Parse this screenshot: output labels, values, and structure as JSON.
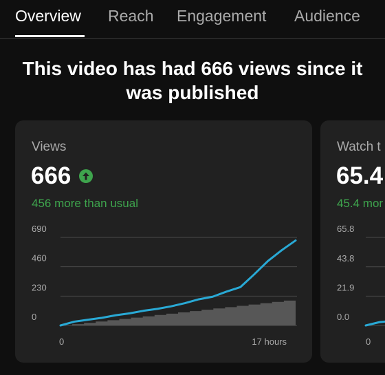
{
  "tabs": [
    {
      "label": "Overview",
      "active": true
    },
    {
      "label": "Reach",
      "active": false
    },
    {
      "label": "Engagement",
      "active": false
    },
    {
      "label": "Audience",
      "active": false
    }
  ],
  "headline": "This video has had 666 views since it was published",
  "cards": [
    {
      "label": "Views",
      "value": "666",
      "trend_icon": "arrow-up-circle-icon",
      "delta": "456 more than usual"
    },
    {
      "label": "Watch t",
      "value": "65.4",
      "delta": "45.4 mor"
    }
  ],
  "colors": {
    "background": "#0f0f0f",
    "card": "#212121",
    "accent_line": "#29a9d5",
    "typical_range": "#575757",
    "positive": "#3ea44d",
    "muted_text": "#aaaaaa"
  },
  "chart_data": [
    {
      "type": "line",
      "ylim": [
        0,
        690
      ],
      "y_ticks": [
        "690",
        "460",
        "230",
        "0"
      ],
      "y_tick_values": [
        690,
        460,
        230,
        0
      ],
      "x_tick_labels": [
        "0",
        "17 hours"
      ],
      "grid": true,
      "series": [
        {
          "x": [
            0,
            1,
            2,
            3,
            4,
            5,
            6,
            7,
            8,
            9,
            10,
            11,
            12,
            13,
            14,
            15,
            16,
            17
          ],
          "values": [
            0,
            30,
            45,
            60,
            80,
            95,
            115,
            130,
            150,
            175,
            205,
            225,
            265,
            300,
            400,
            505,
            590,
            666
          ]
        },
        {
          "x": [
            0,
            17
          ],
          "values": [
            0,
            205
          ]
        }
      ]
    },
    {
      "type": "line",
      "ylim": [
        0,
        65.8
      ],
      "y_ticks": [
        "65.8",
        "43.8",
        "21.9",
        "0.0"
      ],
      "y_tick_values": [
        65.8,
        43.8,
        21.9,
        0
      ],
      "x_tick_labels": [
        "0"
      ],
      "grid": true,
      "series": [
        {
          "x": [
            0,
            1,
            2
          ],
          "values": [
            0,
            2.5,
            3.5
          ]
        }
      ]
    }
  ]
}
